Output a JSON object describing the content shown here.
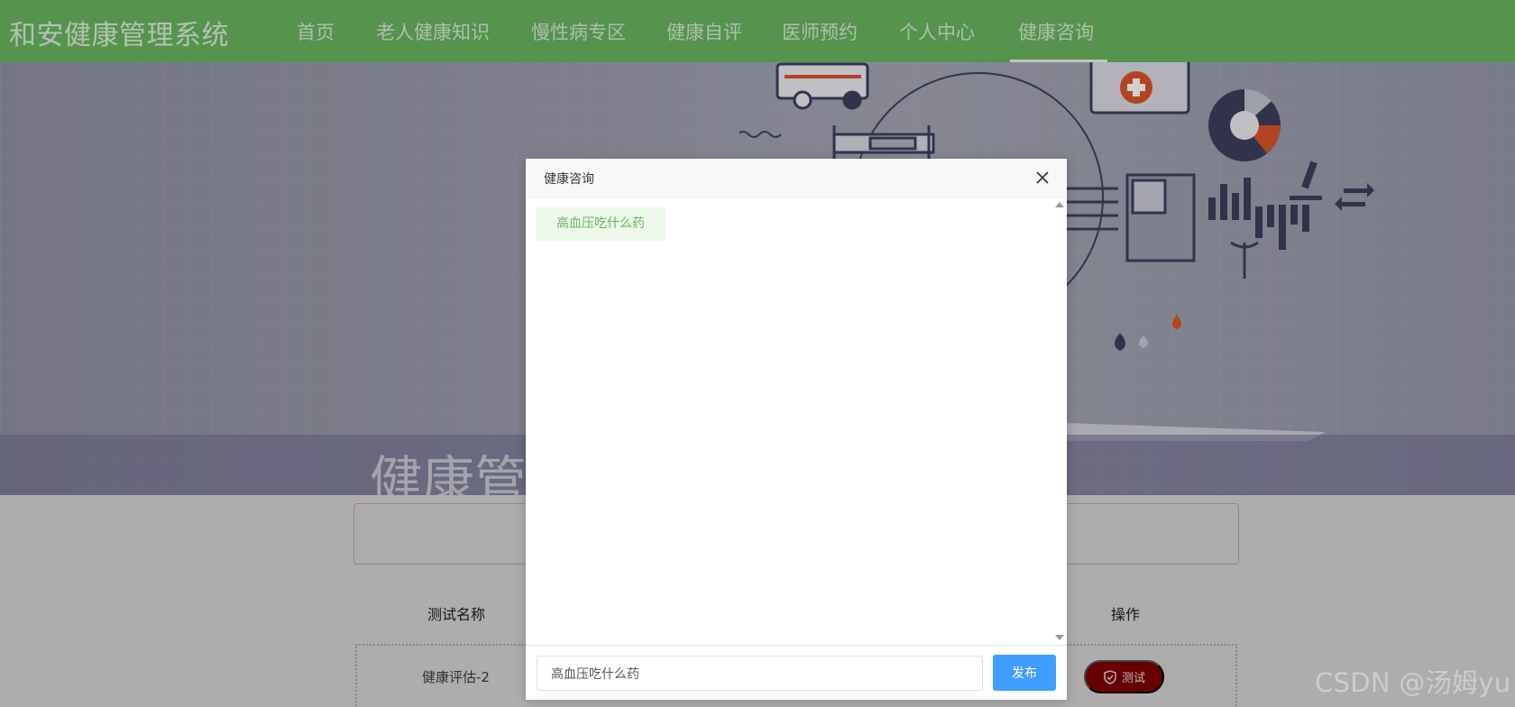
{
  "nav": {
    "brand": "和安健康管理系统",
    "items": [
      "首页",
      "老人健康知识",
      "慢性病专区",
      "健康自评",
      "医师预约",
      "个人中心",
      "健康咨询"
    ],
    "active_index": 6
  },
  "hero": {
    "title": "健康管理"
  },
  "table": {
    "headers": [
      "测试名称",
      "操作"
    ],
    "rows": [
      {
        "name": "健康评估-2",
        "action": "测试"
      }
    ]
  },
  "dialog": {
    "title": "健康咨询",
    "messages": [
      "高血压吃什么药"
    ],
    "input_value": "高血压吃什么药",
    "publish_label": "发布"
  },
  "watermark": "CSDN @汤姆yu",
  "colors": {
    "nav_green": "#67b55e",
    "publish_blue": "#409eff",
    "test_red": "#7e0000",
    "bubble_bg": "#eef8ea"
  }
}
